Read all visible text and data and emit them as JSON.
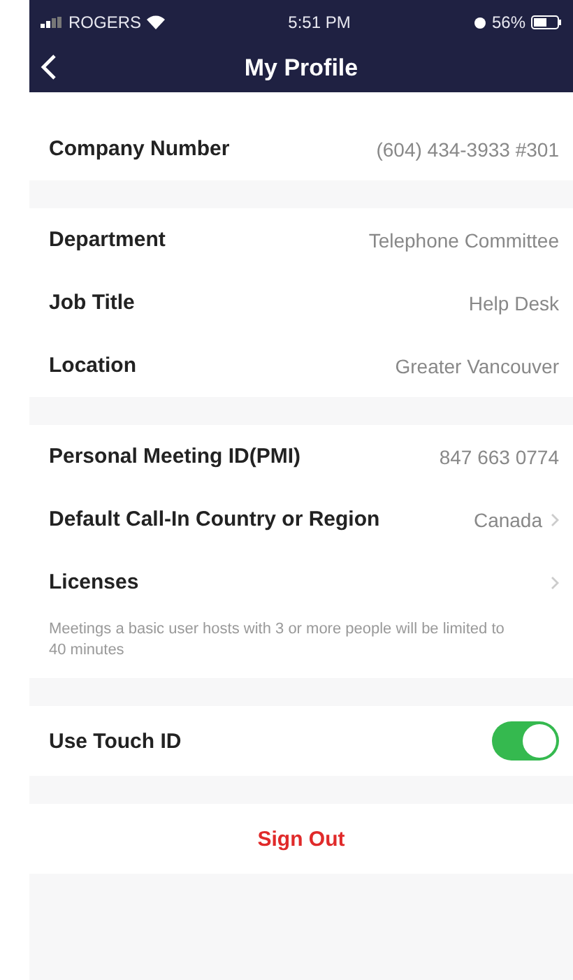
{
  "status_bar": {
    "carrier": "ROGERS",
    "time": "5:51 PM",
    "battery": "56%"
  },
  "header": {
    "title": "My Profile"
  },
  "sections": [
    {
      "rows": [
        {
          "label": "Company Number",
          "value": "(604) 434-3933 #301",
          "chevron": false
        }
      ]
    },
    {
      "rows": [
        {
          "label": "Department",
          "value": "Telephone Committee",
          "chevron": false
        },
        {
          "label": "Job Title",
          "value": "Help Desk",
          "chevron": false
        },
        {
          "label": "Location",
          "value": "Greater Vancouver",
          "chevron": false
        }
      ]
    },
    {
      "rows": [
        {
          "label": "Personal Meeting ID(PMI)",
          "value": "847 663 0774",
          "chevron": false
        },
        {
          "label": "Default Call-In Country or Region",
          "value": "Canada",
          "chevron": true
        },
        {
          "label": "Licenses",
          "chevron": true
        }
      ],
      "note": "Meetings a basic user hosts with 3 or more people will be limited to 40 minutes"
    }
  ],
  "touch_id": {
    "label": "Use Touch ID",
    "on": true
  },
  "sign_out": "Sign Out"
}
